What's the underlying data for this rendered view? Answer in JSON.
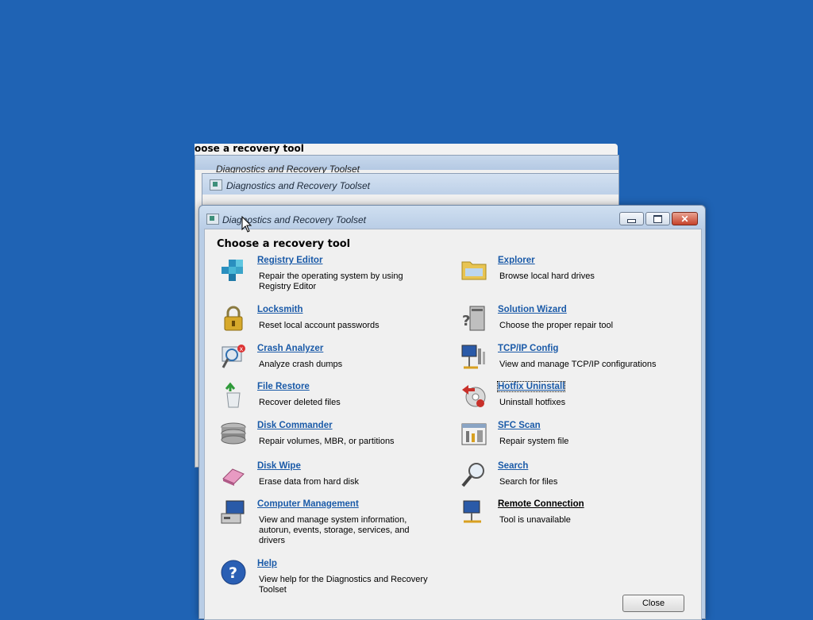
{
  "background_windows": {
    "strip_title": "oose a recovery tool",
    "window1_title": "Diagnostics and Recovery Toolset",
    "window2_title": "Diagnostics and Recovery Toolset"
  },
  "window": {
    "title": "Diagnostics and Recovery Toolset",
    "minimize": "minimize",
    "maximize": "maximize",
    "close": "close",
    "close_glyph": "✕"
  },
  "heading": "Choose a recovery tool",
  "tools": [
    {
      "name": "Registry Editor",
      "desc": "Repair the operating system by using Registry Editor",
      "icon": "registry-icon"
    },
    {
      "name": "Locksmith",
      "desc": "Reset local account passwords",
      "icon": "padlock-icon"
    },
    {
      "name": "Crash Analyzer",
      "desc": "Analyze crash dumps",
      "icon": "crash-icon"
    },
    {
      "name": "File Restore",
      "desc": "Recover deleted files",
      "icon": "recycle-icon"
    },
    {
      "name": "Disk Commander",
      "desc": "Repair volumes, MBR, or partitions",
      "icon": "disk-stack-icon"
    },
    {
      "name": "Disk Wipe",
      "desc": "Erase data from hard disk",
      "icon": "eraser-icon"
    },
    {
      "name": "Computer Management",
      "desc": "View and manage system information, autorun, events, storage, services, and drivers",
      "icon": "computer-management-icon"
    },
    {
      "name": "Help",
      "desc": "View help for the Diagnostics and Recovery Toolset",
      "icon": "help-icon"
    },
    {
      "name": "Explorer",
      "desc": "Browse local hard drives",
      "icon": "folder-icon"
    },
    {
      "name": "Solution Wizard",
      "desc": "Choose the proper repair tool",
      "icon": "wizard-icon"
    },
    {
      "name": "TCP/IP Config",
      "desc": "View and manage TCP/IP configurations",
      "icon": "network-config-icon"
    },
    {
      "name": "Hotfix Uninstall",
      "desc": "Uninstall hotfixes",
      "icon": "hotfix-icon"
    },
    {
      "name": "SFC Scan",
      "desc": "Repair system file",
      "icon": "sfc-icon"
    },
    {
      "name": "Search",
      "desc": "Search for files",
      "icon": "magnifier-icon"
    },
    {
      "name": "Remote Connection",
      "desc": "Tool is unavailable",
      "icon": "remote-icon",
      "disabled": true
    }
  ],
  "close_button": "Close",
  "colors": {
    "desktop": "#1f63b4",
    "link": "#1a5aa8"
  }
}
